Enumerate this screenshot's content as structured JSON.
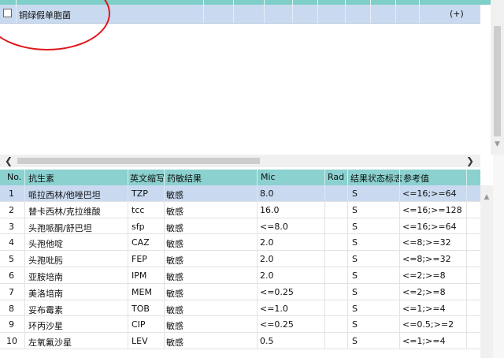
{
  "top_grid": {
    "organism_name": "铜绿假单胞菌",
    "plus_label": "(+)"
  },
  "bottom_grid": {
    "headers": [
      "No.",
      "抗生素",
      "英文缩写",
      "药敏结果",
      "Mic",
      "Rad",
      "结果状态标志",
      "参考值"
    ],
    "rows": [
      {
        "no": "1",
        "name": "哌拉西林/他唑巴坦",
        "abbr": "TZP",
        "result": "敏感",
        "mic": "8.0",
        "rad": "",
        "flag": "S",
        "ref": "<=16;>=64"
      },
      {
        "no": "2",
        "name": "替卡西林/克拉维酸",
        "abbr": "tcc",
        "result": "敏感",
        "mic": "16.0",
        "rad": "",
        "flag": "S",
        "ref": "<=16;>=128"
      },
      {
        "no": "3",
        "name": "头孢哌酮/舒巴坦",
        "abbr": "sfp",
        "result": "敏感",
        "mic": "<=8.0",
        "rad": "",
        "flag": "S",
        "ref": "<=16;>=64"
      },
      {
        "no": "4",
        "name": "头孢他啶",
        "abbr": "CAZ",
        "result": "敏感",
        "mic": "2.0",
        "rad": "",
        "flag": "S",
        "ref": "<=8;>=32"
      },
      {
        "no": "5",
        "name": "头孢吡肟",
        "abbr": "FEP",
        "result": "敏感",
        "mic": "2.0",
        "rad": "",
        "flag": "S",
        "ref": "<=8;>=32"
      },
      {
        "no": "6",
        "name": "亚胺培南",
        "abbr": "IPM",
        "result": "敏感",
        "mic": "2.0",
        "rad": "",
        "flag": "S",
        "ref": "<=2;>=8"
      },
      {
        "no": "7",
        "name": "美洛培南",
        "abbr": "MEM",
        "result": "敏感",
        "mic": "<=0.25",
        "rad": "",
        "flag": "S",
        "ref": "<=2;>=8"
      },
      {
        "no": "8",
        "name": "妥布霉素",
        "abbr": "TOB",
        "result": "敏感",
        "mic": "<=1.0",
        "rad": "",
        "flag": "S",
        "ref": "<=1;>=4"
      },
      {
        "no": "9",
        "name": "环丙沙星",
        "abbr": "CIP",
        "result": "敏感",
        "mic": "<=0.25",
        "rad": "",
        "flag": "S",
        "ref": "<=0.5;>=2"
      },
      {
        "no": "10",
        "name": "左氧氟沙星",
        "abbr": "LEV",
        "result": "敏感",
        "mic": "0.5",
        "rad": "",
        "flag": "S",
        "ref": "<=1;>=4"
      }
    ]
  },
  "colors": {
    "header_teal": "#8ad1cf",
    "selected_row": "#c9daf0",
    "annotation_red": "#e0161a"
  }
}
